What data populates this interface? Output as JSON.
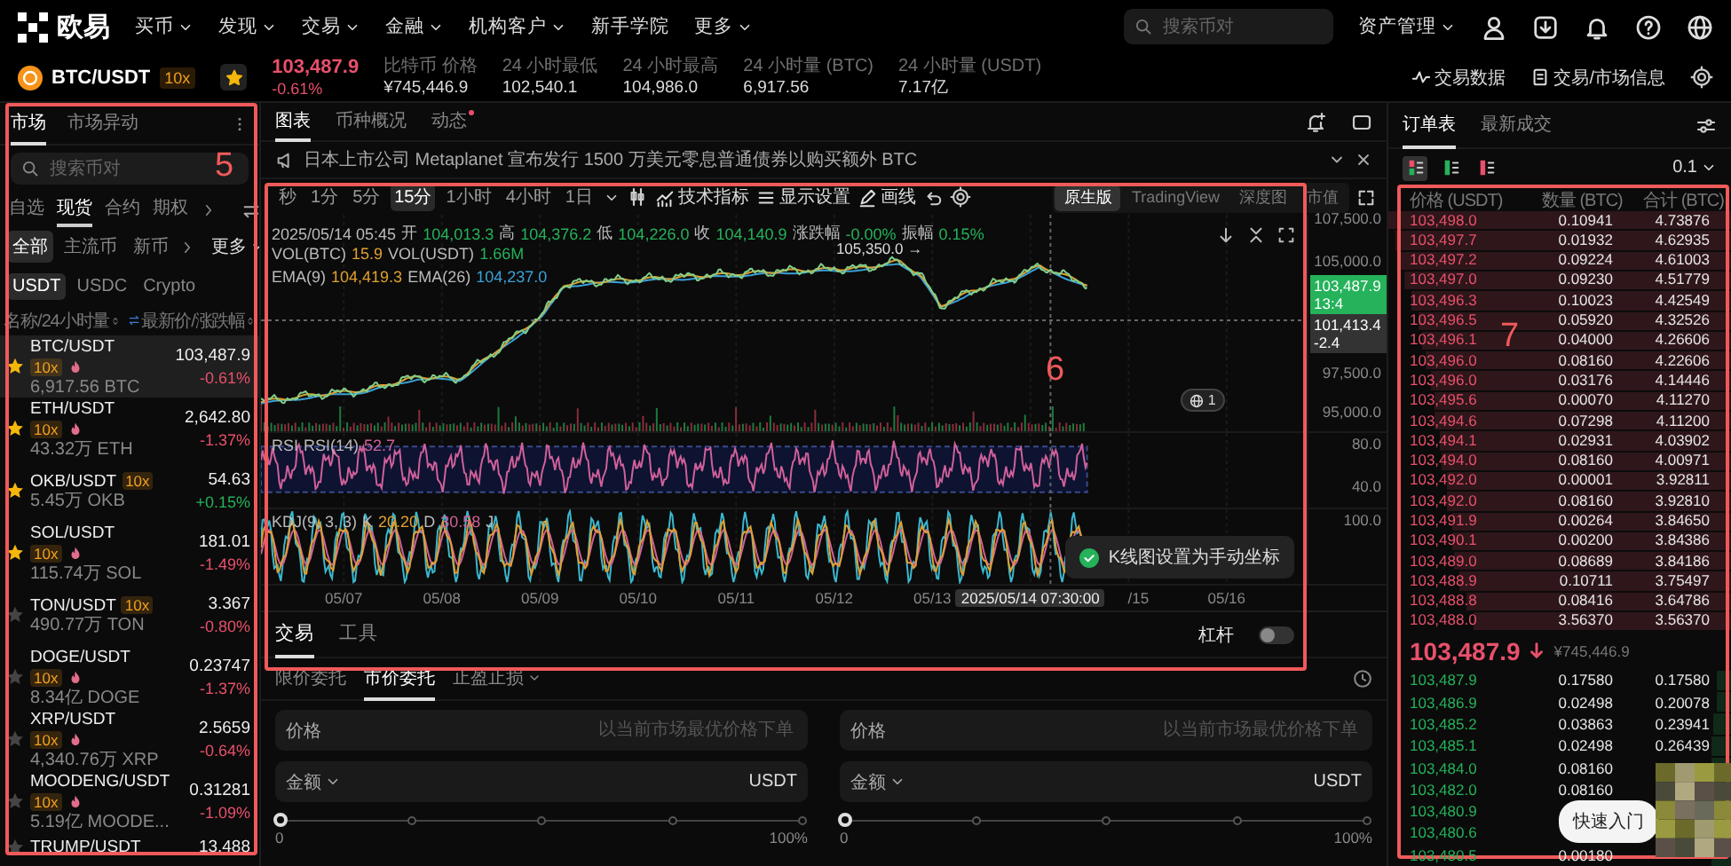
{
  "nav": {
    "logo": "欧易",
    "menu": [
      {
        "label": "买币",
        "dropdown": true
      },
      {
        "label": "发现",
        "dropdown": true
      },
      {
        "label": "交易",
        "dropdown": true
      },
      {
        "label": "金融",
        "dropdown": true
      },
      {
        "label": "机构客户",
        "dropdown": true
      },
      {
        "label": "新手学院",
        "dropdown": false
      },
      {
        "label": "更多",
        "dropdown": true
      }
    ],
    "search": {
      "placeholder": "搜索币对"
    },
    "assets": "资产管理"
  },
  "ticker": {
    "pair": "BTC/USDT",
    "leverage": "10x",
    "favorite": true,
    "price": "103,487.9",
    "change": "-0.61%",
    "stats": [
      {
        "label": "比特币 价格",
        "value": "¥745,446.9"
      },
      {
        "label": "24 小时最低",
        "value": "102,540.1"
      },
      {
        "label": "24 小时最高",
        "value": "104,986.0"
      },
      {
        "label": "24 小时量 (BTC)",
        "value": "6,917.56"
      },
      {
        "label": "24 小时量 (USDT)",
        "value": "7.17亿"
      }
    ],
    "links": [
      "交易数据",
      "交易/市场信息"
    ]
  },
  "market": {
    "tabs": [
      {
        "label": "市场",
        "selected": true
      },
      {
        "label": "市场异动",
        "selected": false
      }
    ],
    "search": {
      "placeholder": "搜索币对"
    },
    "categories": [
      {
        "label": "自选",
        "selected": false
      },
      {
        "label": "现货",
        "selected": true
      },
      {
        "label": "合约",
        "selected": false
      },
      {
        "label": "期权",
        "selected": false
      }
    ],
    "filters": [
      {
        "label": "全部",
        "selected": true
      },
      {
        "label": "主流币",
        "selected": false
      },
      {
        "label": "新币",
        "selected": false
      }
    ],
    "more": "更多",
    "quotes": [
      {
        "label": "USDT",
        "selected": true
      },
      {
        "label": "USDC",
        "selected": false
      },
      {
        "label": "Crypto",
        "selected": false
      }
    ],
    "header": {
      "name": "名称 / 24 小时量",
      "price": "最新价/涨跌幅"
    },
    "rows": [
      {
        "pair": "BTC/USDT",
        "leverage": "10x",
        "hot": true,
        "volume": "6,917.56 BTC",
        "price": "103,487.9",
        "change": "-0.61%",
        "color": "#e9506b",
        "starred": true,
        "selected": true
      },
      {
        "pair": "ETH/USDT",
        "leverage": "10x",
        "hot": true,
        "volume": "43.32万 ETH",
        "price": "2,642.80",
        "change": "-1.37%",
        "color": "#e9506b",
        "starred": true,
        "selected": false
      },
      {
        "pair": "OKB/USDT",
        "leverage": "10x",
        "hot": false,
        "volume": "5.45万 OKB",
        "price": "54.63",
        "change": "+0.15%",
        "color": "#25b25a",
        "starred": true,
        "selected": false
      },
      {
        "pair": "SOL/USDT",
        "leverage": "10x",
        "hot": true,
        "volume": "115.74万 SOL",
        "price": "181.01",
        "change": "-1.49%",
        "color": "#e9506b",
        "starred": true,
        "selected": false
      },
      {
        "pair": "TON/USDT",
        "leverage": "10x",
        "hot": false,
        "volume": "490.77万 TON",
        "price": "3.367",
        "change": "-0.80%",
        "color": "#e9506b",
        "starred": false,
        "selected": false
      },
      {
        "pair": "DOGE/USDT",
        "leverage": "10x",
        "hot": true,
        "volume": "8.34亿 DOGE",
        "price": "0.23747",
        "change": "-1.37%",
        "color": "#e9506b",
        "starred": false,
        "selected": false
      },
      {
        "pair": "XRP/USDT",
        "leverage": "10x",
        "hot": true,
        "volume": "4,340.76万 XRP",
        "price": "2.5659",
        "change": "-0.64%",
        "color": "#e9506b",
        "starred": false,
        "selected": false
      },
      {
        "pair": "MOODENG/USDT",
        "leverage": "10x",
        "hot": true,
        "volume": "5.19亿 MOODE...",
        "price": "0.31281",
        "change": "-1.09%",
        "color": "#e9506b",
        "starred": false,
        "selected": false
      },
      {
        "pair": "TRUMP/USDT",
        "price": "13.488",
        "starred": false,
        "selected": false
      }
    ]
  },
  "chart": {
    "tabs": [
      {
        "label": "图表",
        "selected": true,
        "dot": false
      },
      {
        "label": "币种概况",
        "selected": false,
        "dot": false
      },
      {
        "label": "动态",
        "selected": false,
        "dot": true
      }
    ],
    "news": "日本上市公司 Metaplanet 宣布发行 1500 万美元零息普通债券以购买额外 BTC",
    "intervals": [
      {
        "label": "秒",
        "selected": false
      },
      {
        "label": "1分",
        "selected": false
      },
      {
        "label": "5分",
        "selected": false
      },
      {
        "label": "15分",
        "selected": true
      },
      {
        "label": "1小时",
        "selected": false
      },
      {
        "label": "4小时",
        "selected": false
      },
      {
        "label": "1日",
        "selected": false
      }
    ],
    "tools": [
      "技术指标",
      "显示设置",
      "画线"
    ],
    "views": [
      {
        "label": "原生版",
        "selected": true
      },
      {
        "label": "TradingView",
        "selected": false
      },
      {
        "label": "深度图",
        "selected": false
      },
      {
        "label": "市值",
        "selected": false
      }
    ],
    "ohlc_time": "2025/05/14 05:45",
    "ohlc": [
      {
        "label": "开",
        "value": "104,013.3"
      },
      {
        "label": "高",
        "value": "104,376.2"
      },
      {
        "label": "低",
        "value": "104,226.0"
      },
      {
        "label": "收",
        "value": "104,140.9"
      },
      {
        "label": "涨跌幅",
        "value": "-0.00%"
      },
      {
        "label": "振幅",
        "value": "0.15%"
      }
    ],
    "vol": [
      {
        "label": "VOL(BTC)",
        "value": "15.9"
      },
      {
        "label": "VOL(USDT)",
        "value": "1.66M"
      }
    ],
    "ema": [
      {
        "label": "EMA(9)",
        "value": "104,419.3"
      },
      {
        "label": "EMA(26)",
        "value": "104,237.0"
      }
    ],
    "high_marker": "105,350.0 →",
    "price_axis": [
      "107,500.0",
      "105,000.0",
      "97,500.0",
      "95,000.0"
    ],
    "last_price": {
      "value": "103,487.9",
      "countdown": "13:4"
    },
    "cursor_price": {
      "value": "101,413.4",
      "change": "-2.4"
    },
    "alert_count": "1",
    "rsi": {
      "title": "RSI",
      "label": "RSI(14)",
      "value": "52.7"
    },
    "rsi_axis": [
      "80.0",
      "40.0"
    ],
    "kdj": {
      "label": "KDJ(9, 3, 3)",
      "lines": [
        {
          "label": "K",
          "value": "20.20"
        },
        {
          "label": "D",
          "value": "30.58"
        },
        {
          "label": "J"
        }
      ]
    },
    "kdj_axis": [
      "100.0"
    ],
    "dates": [
      "05/07",
      "05/08",
      "05/09",
      "05/10",
      "05/11",
      "05/12",
      "05/13",
      "/15",
      "05/16"
    ],
    "cursor_time": "2025/05/14 07:30:00",
    "toast": "K线图设置为手动坐标"
  },
  "trade": {
    "tabs": [
      {
        "label": "交易",
        "selected": true
      },
      {
        "label": "工具",
        "selected": false
      }
    ],
    "leverage": {
      "label": "杠杆",
      "on": false
    },
    "order_types": [
      {
        "label": "限价委托",
        "selected": false,
        "dropdown": false
      },
      {
        "label": "市价委托",
        "selected": true,
        "dropdown": false
      },
      {
        "label": "止盈止损",
        "selected": false,
        "dropdown": true
      }
    ],
    "forms": [
      {
        "price_label": "价格",
        "placeholder": "以当前市场最优价格下单",
        "amount_label": "金额",
        "unit": "USDT",
        "level": 0,
        "min": "0",
        "max": "100%"
      },
      {
        "price_label": "价格",
        "placeholder": "以当前市场最优价格下单",
        "amount_label": "金额",
        "unit": "USDT",
        "level": 0,
        "min": "0",
        "max": "100%"
      }
    ]
  },
  "book": {
    "tabs": [
      {
        "label": "订单表",
        "selected": true
      },
      {
        "label": "最新成交",
        "selected": false
      }
    ],
    "views": [
      {
        "kind": "both",
        "selected": true
      },
      {
        "kind": "bids",
        "selected": false
      },
      {
        "kind": "asks",
        "selected": false
      }
    ],
    "step": "0.1",
    "columns": [
      "价格 (USDT)",
      "数量 (BTC)",
      "合计 (BTC)"
    ],
    "asks": [
      {
        "price": "103,498.0",
        "amount": "0.10941",
        "total": "4.73876"
      },
      {
        "price": "103,497.7",
        "amount": "0.01932",
        "total": "4.62935"
      },
      {
        "price": "103,497.2",
        "amount": "0.09224",
        "total": "4.61003"
      },
      {
        "price": "103,497.0",
        "amount": "0.09230",
        "total": "4.51779"
      },
      {
        "price": "103,496.3",
        "amount": "0.10023",
        "total": "4.42549"
      },
      {
        "price": "103,496.5",
        "amount": "0.05920",
        "total": "4.32526"
      },
      {
        "price": "103,496.1",
        "amount": "0.04000",
        "total": "4.26606"
      },
      {
        "price": "103,496.0",
        "amount": "0.08160",
        "total": "4.22606"
      },
      {
        "price": "103,496.0",
        "amount": "0.03176",
        "total": "4.14446"
      },
      {
        "price": "103,495.6",
        "amount": "0.00070",
        "total": "4.11270"
      },
      {
        "price": "103,494.6",
        "amount": "0.07298",
        "total": "4.11200"
      },
      {
        "price": "103,494.1",
        "amount": "0.02931",
        "total": "4.03902"
      },
      {
        "price": "103,494.0",
        "amount": "0.08160",
        "total": "4.00971"
      },
      {
        "price": "103,492.0",
        "amount": "0.00001",
        "total": "3.92811"
      },
      {
        "price": "103,492.0",
        "amount": "0.08160",
        "total": "3.92810"
      },
      {
        "price": "103,491.9",
        "amount": "0.00264",
        "total": "3.84650"
      },
      {
        "price": "103,490.1",
        "amount": "0.00200",
        "total": "3.84386"
      },
      {
        "price": "103,489.0",
        "amount": "0.08689",
        "total": "3.84186"
      },
      {
        "price": "103,488.9",
        "amount": "0.10711",
        "total": "3.75497"
      },
      {
        "price": "103,488.8",
        "amount": "0.08416",
        "total": "3.64786"
      },
      {
        "price": "103,488.0",
        "amount": "3.56370",
        "total": "3.56370"
      }
    ],
    "mid": {
      "price": "103,487.9",
      "fiat": "¥745,446.9"
    },
    "bids": [
      {
        "price": "103,487.9",
        "amount": "0.17580",
        "total": "0.17580"
      },
      {
        "price": "103,486.9",
        "amount": "0.02498",
        "total": "0.20078"
      },
      {
        "price": "103,485.2",
        "amount": "0.03863",
        "total": "0.23941"
      },
      {
        "price": "103,485.1",
        "amount": "0.02498",
        "total": "0.26439"
      },
      {
        "price": "103,484.0",
        "amount": "0.08160"
      },
      {
        "price": "103,482.0",
        "amount": "0.08160"
      },
      {
        "price": "103,480.9"
      },
      {
        "price": "103,480.6"
      },
      {
        "price": "103,480.5",
        "amount": "0.00180"
      }
    ],
    "guide": "快速入门"
  },
  "annotations": [
    {
      "label": "5"
    },
    {
      "label": "6"
    },
    {
      "label": "7"
    }
  ]
}
